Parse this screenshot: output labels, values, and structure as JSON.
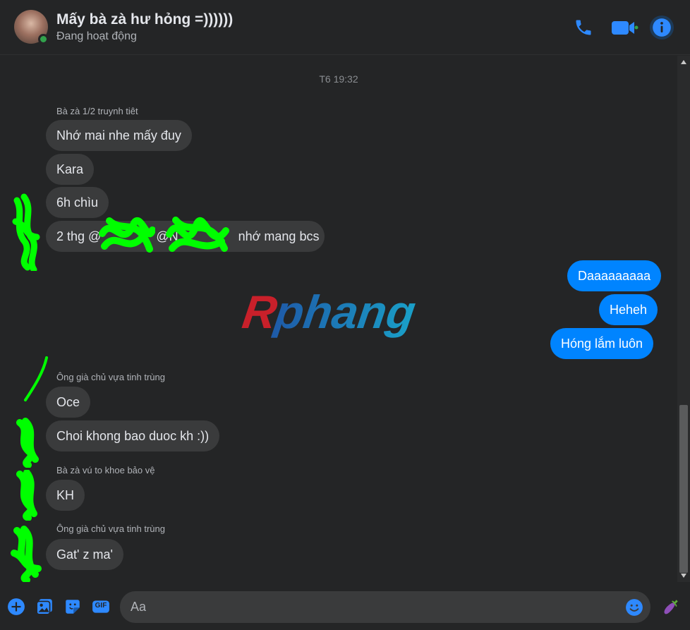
{
  "header": {
    "title": "Mấy bà zà hư hỏng =))))))",
    "status": "Đang hoạt động",
    "icons": [
      "phone-icon",
      "video-call-icon",
      "info-icon"
    ]
  },
  "thread": {
    "timestamp": "T6 19:32",
    "groups": [
      {
        "sender": "Bà zà 1/2 truynh tiêt",
        "messages": [
          "Nhớ mai nhe mấy đuy",
          "Kara",
          "6h chìu",
          "2 thg @",
          "@N",
          "nhớ mang bcs"
        ]
      },
      {
        "sender": "",
        "outgoing": true,
        "messages": [
          "Daaaaaaaaa",
          "Heheh",
          "Hóng lắm luôn"
        ]
      },
      {
        "sender": "Ông già chủ vựa tinh trùng",
        "messages": [
          "Oce",
          "Choi khong bao duoc kh :))"
        ]
      },
      {
        "sender": "Bà zà vú to khoe bảo vệ",
        "messages": [
          "KH"
        ]
      },
      {
        "sender": "Ông già chủ vựa tinh trùng",
        "messages": [
          "Gat' z ma'"
        ]
      }
    ]
  },
  "watermark": {
    "text": "Rphang"
  },
  "composer": {
    "placeholder": "Aa",
    "value": "",
    "icons": [
      "add-icon",
      "photo-icon",
      "sticker-icon",
      "gif-icon",
      "emoji-icon",
      "eggplant-icon"
    ],
    "gif_label": "GIF"
  },
  "colors": {
    "accent": "#0084ff",
    "incoming_bubble": "#3a3b3c",
    "online": "#31a24c",
    "scribble": "#00ff00"
  }
}
